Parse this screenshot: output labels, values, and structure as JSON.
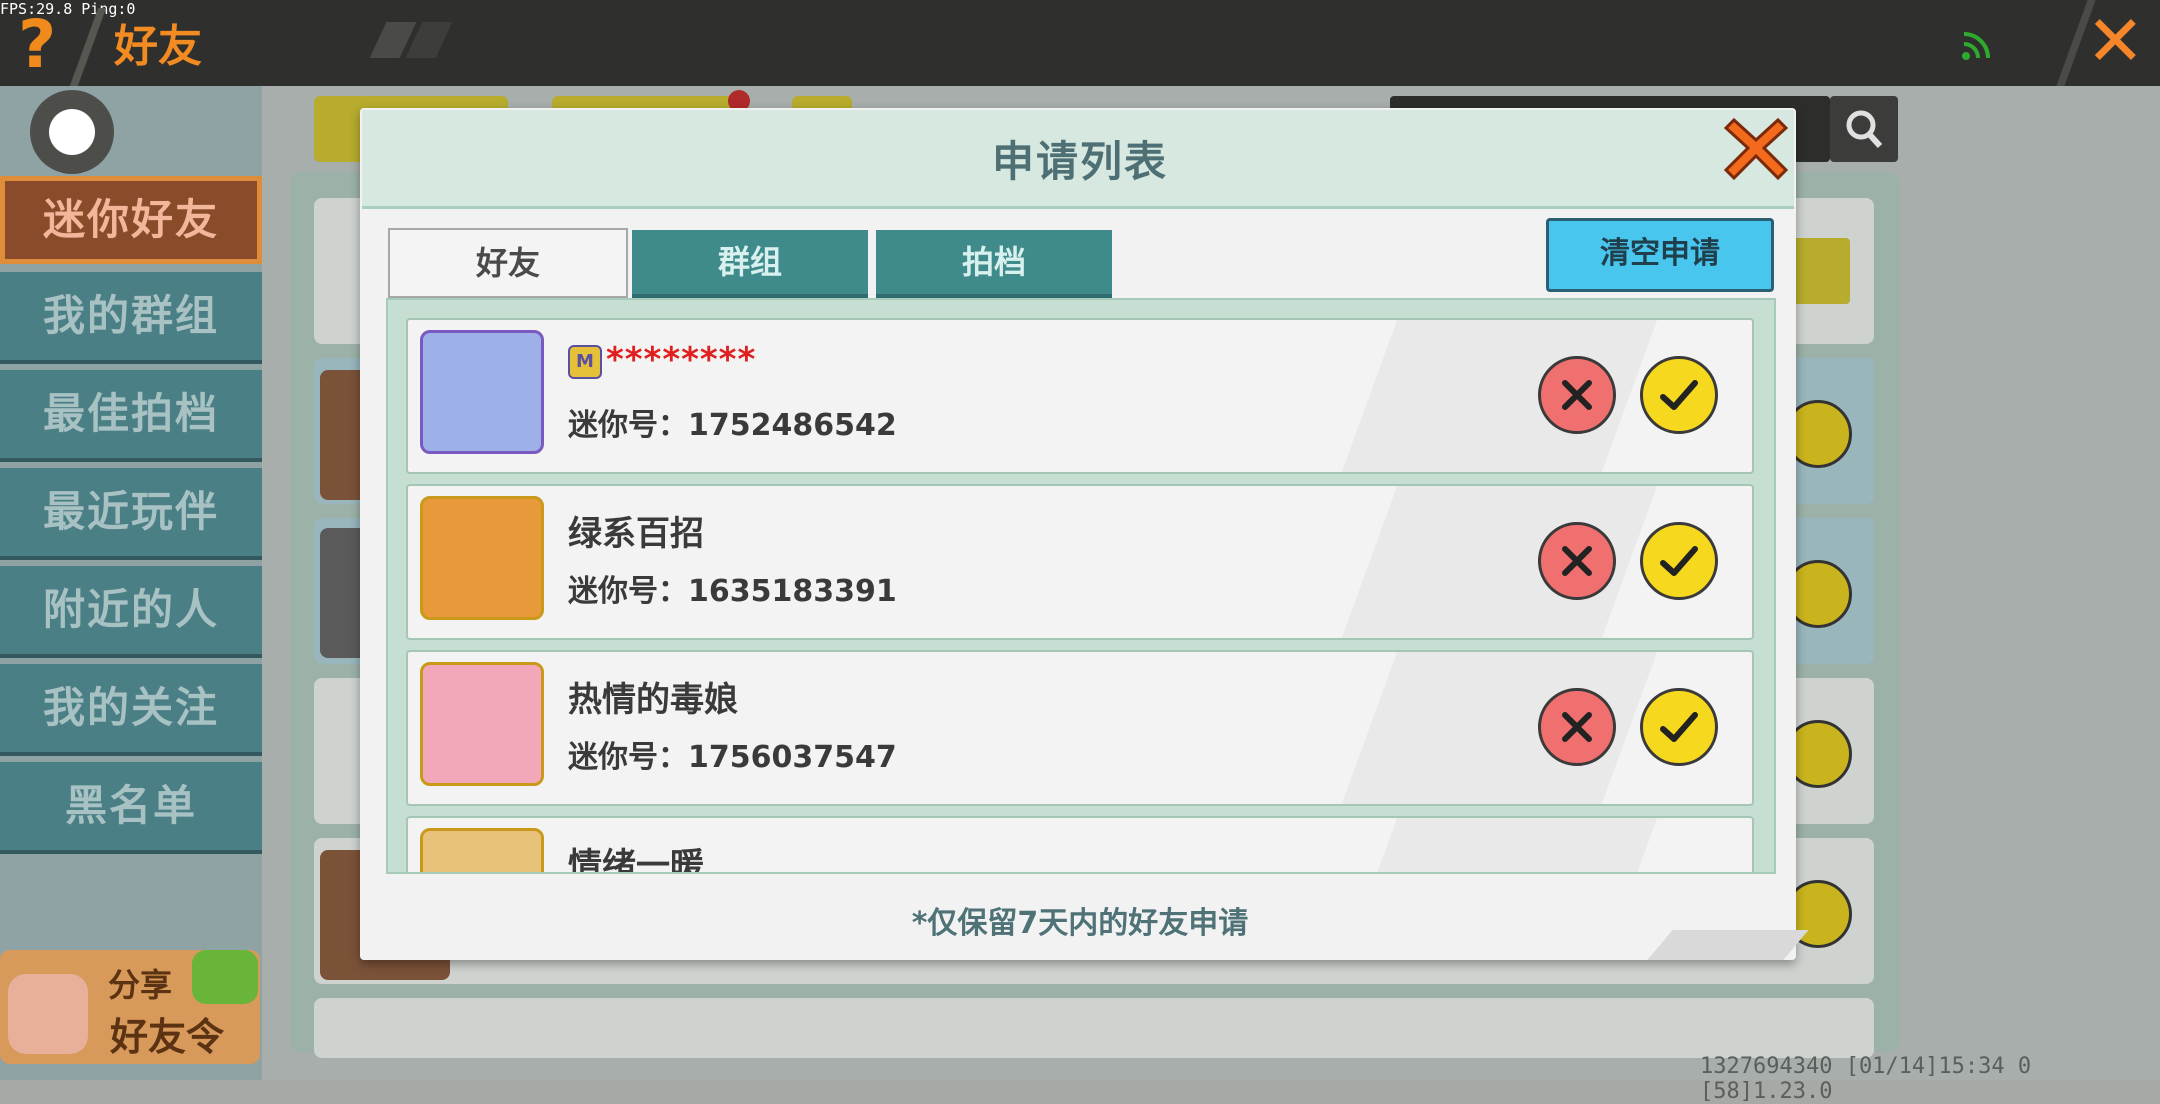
{
  "status": {
    "fps": "FPS:29.8  Ping:0"
  },
  "top_bar": {
    "help": "?",
    "title": "好友"
  },
  "sidebar": {
    "items": [
      {
        "label": "迷你好友",
        "active": true
      },
      {
        "label": "我的群组"
      },
      {
        "label": "最佳拍档"
      },
      {
        "label": "最近玩伴"
      },
      {
        "label": "附近的人"
      },
      {
        "label": "我的关注"
      },
      {
        "label": "黑名单"
      }
    ],
    "share": {
      "line1": "分享",
      "line2": "好友令"
    }
  },
  "modal": {
    "title": "申请列表",
    "tabs": [
      "好友",
      "群组",
      "拍档"
    ],
    "clear_button": "清空申请",
    "requests": [
      {
        "name": "********",
        "mini_id": "迷你号：1752486542",
        "masked": true
      },
      {
        "name": "绿系百招",
        "mini_id": "迷你号：1635183391"
      },
      {
        "name": "热情的毒娘",
        "mini_id": "迷你号：1756037547"
      },
      {
        "name": "情绪一暖",
        "mini_id": ""
      }
    ],
    "footnote": "*仅保留7天内的好友申请"
  },
  "footer_info": "1327694340   [01/14]15:34 0  [58]1.23.0",
  "colors": {
    "accent": "#f28b22",
    "teal": "#3f8a8b",
    "clear_btn": "#49c6ee",
    "confirm": "#f6d91e",
    "reject": "#f07070"
  }
}
